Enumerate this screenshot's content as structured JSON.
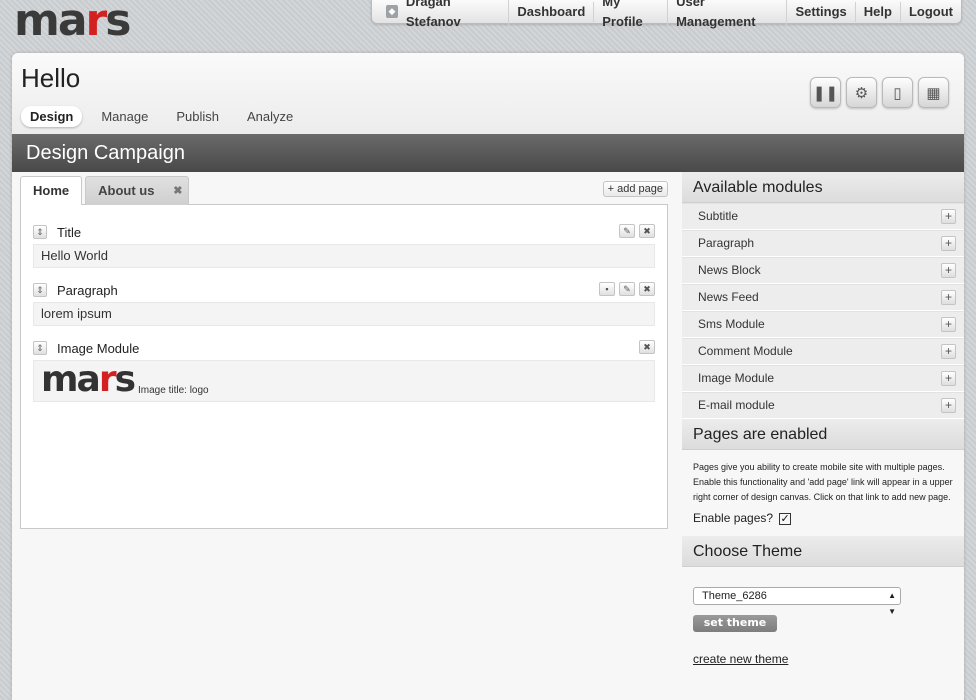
{
  "app": {
    "logo_main": "mars"
  },
  "topnav": {
    "user": "Dragan Stefanov",
    "items": [
      "Dashboard",
      "My Profile",
      "User Management",
      "Settings",
      "Help",
      "Logout"
    ]
  },
  "header": {
    "title": "Hello",
    "tabs": [
      "Design",
      "Manage",
      "Publish",
      "Analyze"
    ],
    "icons": [
      "pause-icon",
      "gear-icon",
      "phone-icon",
      "qr-code-icon"
    ]
  },
  "section": {
    "title": "Design Campaign"
  },
  "canvas": {
    "tabs": [
      "Home",
      "About us"
    ],
    "add_page": "+ add page",
    "modules": [
      {
        "name": "Title",
        "value": "Hello World"
      },
      {
        "name": "Paragraph",
        "value": "lorem ipsum"
      },
      {
        "name": "Image Module",
        "caption": "Image title: logo"
      }
    ]
  },
  "sidebar": {
    "modules_title": "Available modules",
    "modules": [
      "Subtitle",
      "Paragraph",
      "News Block",
      "News Feed",
      "Sms Module",
      "Comment Module",
      "Image Module",
      "E-mail module"
    ],
    "pages_title": "Pages are enabled",
    "pages_desc": "Pages give you ability to create mobile site with multiple pages. Enable this functionality and 'add page' link will appear in a upper right corner of design canvas. Click on that link to add new page.",
    "enable_label": "Enable pages?",
    "enable_checked": true,
    "theme_title": "Choose Theme",
    "theme_value": "Theme_6286",
    "set_theme": "set theme",
    "create_theme": "create new theme"
  },
  "colors": {
    "accent_red": "#d32020",
    "section_bar": "#555555"
  }
}
